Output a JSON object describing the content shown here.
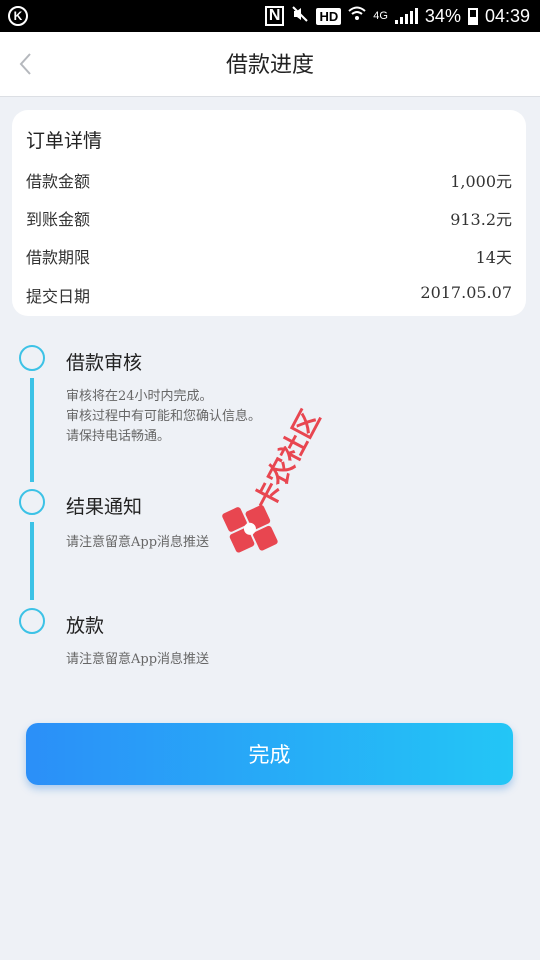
{
  "status_bar": {
    "battery": "34%",
    "time": "04:39",
    "network_badge": "HD",
    "network_type": "4G",
    "nfc_label": "N",
    "left_icon_label": "K",
    "icons": [
      "nfc-icon",
      "mute-icon",
      "wifi-icon",
      "signal-icon",
      "battery-icon"
    ]
  },
  "header": {
    "title": "借款进度",
    "back_icon": "chevron-left-icon"
  },
  "order": {
    "title": "订单详情",
    "rows": [
      {
        "label": "借款金额",
        "value": "1,000元"
      },
      {
        "label": "到账金额",
        "value": "913.2元"
      },
      {
        "label": "借款期限",
        "value": "14天"
      },
      {
        "label": "提交日期",
        "value": "2017.05.07"
      }
    ]
  },
  "timeline": [
    {
      "title": "借款审核",
      "desc": [
        "审核将在24小时内完成。",
        "审核过程中有可能和您确认信息。",
        "请保持电话畅通。"
      ]
    },
    {
      "title": "结果通知",
      "desc": [
        "请注意留意App消息推送"
      ]
    },
    {
      "title": "放款",
      "desc": [
        "请注意留意App消息推送"
      ]
    }
  ],
  "watermark": {
    "text": "卡农社区"
  },
  "done_button": {
    "label": "完成"
  },
  "colors": {
    "accent": "#3cc2e6",
    "button_start": "#2b8ff8",
    "button_end": "#23c6f6",
    "background": "#eef1f6"
  }
}
